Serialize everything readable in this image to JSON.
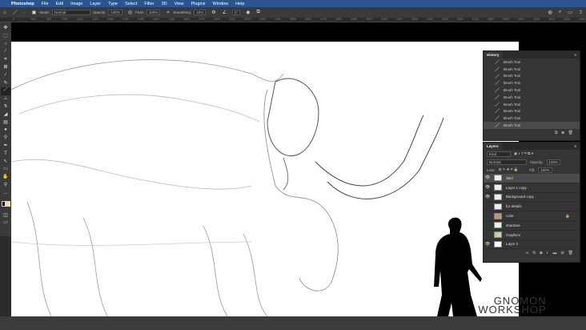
{
  "menu": {
    "app": "Photoshop",
    "items": [
      "File",
      "Edit",
      "Image",
      "Layer",
      "Type",
      "Select",
      "Filter",
      "3D",
      "View",
      "Plugins",
      "Window",
      "Help"
    ]
  },
  "options": {
    "mode_label": "Mode:",
    "mode": "Normal",
    "opacity_label": "Opacity:",
    "opacity": "100%",
    "flow_label": "Flow:",
    "flow": "100%",
    "smoothing_label": "Smoothing:",
    "smoothing": "10%",
    "angle": "0°"
  },
  "ruler": [
    "0",
    "800",
    "900",
    "1000",
    "1100",
    "1200",
    "1300",
    "1400",
    "1500",
    "1600",
    "1700",
    "1800",
    "1900",
    "2000",
    "2100",
    "2200",
    "2300",
    "2400",
    "2500",
    "2600",
    "2700",
    "2800",
    "2900",
    "3000",
    "3100",
    "3200",
    "3300",
    "3400",
    "3500",
    "3600",
    "3700",
    "3800",
    "3900",
    "4000",
    "4100",
    "4200",
    "4300",
    "4400"
  ],
  "history": {
    "title": "History",
    "items": [
      "Brush Tool",
      "Brush Tool",
      "Brush Tool",
      "Brush Tool",
      "Brush Tool",
      "Brush Tool",
      "Brush Tool",
      "Brush Tool",
      "Brush Tool",
      "Brush Tool"
    ]
  },
  "layers": {
    "title": "Layers",
    "filter": "Kind",
    "blend": "Normal",
    "opacity_label": "Opacity:",
    "opacity": "100%",
    "lock_label": "Lock:",
    "fill_label": "Fill:",
    "fill": "100%",
    "items": [
      {
        "name": "Skel",
        "visible": true
      },
      {
        "name": "Layer 1 copy",
        "visible": true
      },
      {
        "name": "Background copy",
        "visible": true
      },
      {
        "name": "fur details",
        "visible": false
      },
      {
        "name": "color",
        "visible": false
      },
      {
        "name": "shadows",
        "visible": false
      },
      {
        "name": "Graphics",
        "visible": false
      },
      {
        "name": "Layer 2",
        "visible": true
      }
    ]
  },
  "watermark": "GNOMON WORKSHOP"
}
